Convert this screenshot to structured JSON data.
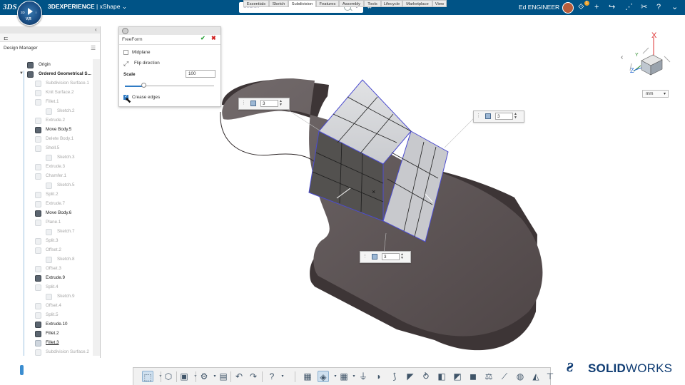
{
  "topbar": {
    "logo": "3DS",
    "compass_center": "V,R",
    "compass_left": "3D",
    "compass_right": "i",
    "brand_bold": "3DEXPERIENCE",
    "brand_sep": " | ",
    "app_name": "xShape",
    "search_placeholder": "Search",
    "user_name": "Ed ENGINEER",
    "notification_count": "1"
  },
  "design_manager": {
    "title": "Design Manager",
    "items": [
      {
        "label": "Origin",
        "state": "bold"
      },
      {
        "label": "Ordered Geometrical S...",
        "state": "bold"
      },
      {
        "label": "Subdivision Surface.1",
        "state": "dim"
      },
      {
        "label": "Knit Surface.2",
        "state": "dim"
      },
      {
        "label": "Fillet.1",
        "state": "dim"
      },
      {
        "label": "Sketch.2",
        "state": "dim"
      },
      {
        "label": "Extrude.2",
        "state": "dim"
      },
      {
        "label": "Move Body.5",
        "state": "bold"
      },
      {
        "label": "Delete Body.1",
        "state": "dim"
      },
      {
        "label": "Shell.5",
        "state": "dim"
      },
      {
        "label": "Sketch.3",
        "state": "dim"
      },
      {
        "label": "Extrude.3",
        "state": "dim"
      },
      {
        "label": "Chamfer.1",
        "state": "dim"
      },
      {
        "label": "Sketch.5",
        "state": "dim"
      },
      {
        "label": "Split.2",
        "state": "dim"
      },
      {
        "label": "Extrude.7",
        "state": "dim"
      },
      {
        "label": "Move Body.6",
        "state": "bold"
      },
      {
        "label": "Plane.1",
        "state": "dim"
      },
      {
        "label": "Sketch.7",
        "state": "dim"
      },
      {
        "label": "Split.3",
        "state": "dim"
      },
      {
        "label": "Offset.2",
        "state": "dim"
      },
      {
        "label": "Sketch.8",
        "state": "dim"
      },
      {
        "label": "Offset.3",
        "state": "dim"
      },
      {
        "label": "Extrude.9",
        "state": "bold"
      },
      {
        "label": "Split.4",
        "state": "dim"
      },
      {
        "label": "Sketch.9",
        "state": "dim"
      },
      {
        "label": "Offset.4",
        "state": "dim"
      },
      {
        "label": "Split.5",
        "state": "dim"
      },
      {
        "label": "Extrude.10",
        "state": "bold"
      },
      {
        "label": "Fillet.2",
        "state": "bold"
      },
      {
        "label": "Fillet.3",
        "state": "sel"
      },
      {
        "label": "Subdivision Surface.2",
        "state": "dim"
      }
    ]
  },
  "freeform": {
    "title": "FreeForm",
    "midplane_label": "Midplane",
    "midplane_checked": false,
    "flip_label": "Flip direction",
    "scale_label": "Scale",
    "scale_value": "100",
    "slider_fraction": 0.2,
    "crease_label": "Crease edges",
    "crease_checked": true
  },
  "spinners": [
    {
      "name": "spinner-left",
      "value": "3"
    },
    {
      "name": "spinner-right",
      "value": "3"
    },
    {
      "name": "spinner-bottom",
      "value": "3"
    }
  ],
  "units": {
    "value": "mm"
  },
  "triad": {
    "x": "X",
    "y": "Y",
    "z": "Z"
  },
  "tabs": [
    "Essentials",
    "Sketch",
    "Subdivision",
    "Features",
    "Assembly",
    "Tools",
    "Lifecycle",
    "Marketplace",
    "View"
  ],
  "active_tab": "Subdivision",
  "solidworks": {
    "prefix": "SOLID",
    "suffix": "WORKS"
  },
  "colors": {
    "topbar": "#005386",
    "accent": "#2f7bc4",
    "model": "#5e5556",
    "cube": "#c9cbcf"
  }
}
